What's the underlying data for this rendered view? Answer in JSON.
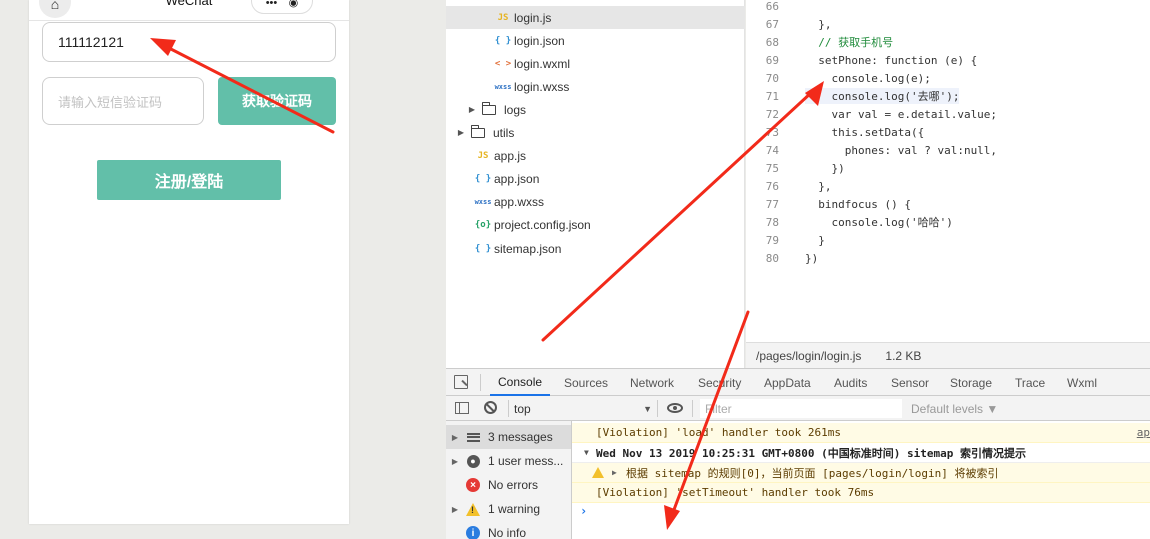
{
  "simulator": {
    "title": "WeChat",
    "phone_value": "111112121",
    "code_placeholder": "请输入短信验证码",
    "get_code_label": "获取验证码",
    "register_label": "注册/登陆"
  },
  "file_tree": [
    {
      "name": "login.js",
      "icon": "js-icon",
      "glyph": "JS",
      "active": true
    },
    {
      "name": "login.json",
      "icon": "json-icon",
      "glyph": "{ }"
    },
    {
      "name": "login.wxml",
      "icon": "wxml-icon",
      "glyph": "< >"
    },
    {
      "name": "login.wxss",
      "icon": "wxss-icon",
      "glyph": "wxss"
    },
    {
      "name": "logs",
      "icon": "folder-icon",
      "folder": true
    },
    {
      "name": "utils",
      "icon": "folder-icon",
      "folder": true
    },
    {
      "name": "app.js",
      "icon": "js-icon",
      "glyph": "JS"
    },
    {
      "name": "app.json",
      "icon": "json-icon",
      "glyph": "{ }"
    },
    {
      "name": "app.wxss",
      "icon": "wxss-icon",
      "glyph": "wxss"
    },
    {
      "name": "project.config.json",
      "icon": "config-icon",
      "glyph": "{o}"
    },
    {
      "name": "sitemap.json",
      "icon": "json-icon",
      "glyph": "{ }"
    }
  ],
  "editor": {
    "lines": [
      {
        "num": "66",
        "code": ""
      },
      {
        "num": "67",
        "code": "  },"
      },
      {
        "num": "68",
        "code": "  // 获取手机号",
        "type": "comment"
      },
      {
        "num": "69",
        "code": "  setPhone: function (e) {"
      },
      {
        "num": "70",
        "code": "    console.log(e);"
      },
      {
        "num": "71",
        "code": "    console.log('去哪');",
        "highlight": true
      },
      {
        "num": "72",
        "code": "    var val = e.detail.value;"
      },
      {
        "num": "73",
        "code": "    this.setData({"
      },
      {
        "num": "74",
        "code": "      phones: val ? val:null,"
      },
      {
        "num": "75",
        "code": "    })"
      },
      {
        "num": "76",
        "code": "  },"
      },
      {
        "num": "77",
        "code": "  bindfocus () {"
      },
      {
        "num": "78",
        "code": "    console.log('哈哈')"
      },
      {
        "num": "79",
        "code": "  }"
      },
      {
        "num": "80",
        "code": "})"
      }
    ],
    "status_path": "/pages/login/login.js",
    "status_size": "1.2 KB"
  },
  "devtools": {
    "tabs": [
      "Console",
      "Sources",
      "Network",
      "Security",
      "AppData",
      "Audits",
      "Sensor",
      "Storage",
      "Trace",
      "Wxml"
    ],
    "active_tab": "Console",
    "context": "top",
    "filter_placeholder": "Filter",
    "levels_label": "Default levels ▼",
    "sidebar": [
      {
        "label": "3 messages",
        "icon": "list-icon",
        "active": true
      },
      {
        "label": "1 user mess...",
        "icon": "user-icon"
      },
      {
        "label": "No errors",
        "icon": "error-icon"
      },
      {
        "label": "1 warning",
        "icon": "warning-icon"
      },
      {
        "label": "No info",
        "icon": "info-icon"
      }
    ],
    "console": [
      {
        "text": "[Violation] 'load' handler took 261ms",
        "source": "ap",
        "type": "warn"
      },
      {
        "text": "Wed Nov 13 2019 10:25:31 GMT+0800 (中国标准时间) sitemap 索引情况提示",
        "type": "group"
      },
      {
        "text": "根据 sitemap 的规则[0]，当前页面 [pages/login/login] 将被索引",
        "type": "warn-nested"
      },
      {
        "text": "[Violation] 'setTimeout' handler took 76ms",
        "type": "warn"
      }
    ]
  },
  "colors": {
    "accent_green": "#62bfa9",
    "arrow_red": "#f22a1a",
    "tab_blue": "#1a73e8"
  }
}
